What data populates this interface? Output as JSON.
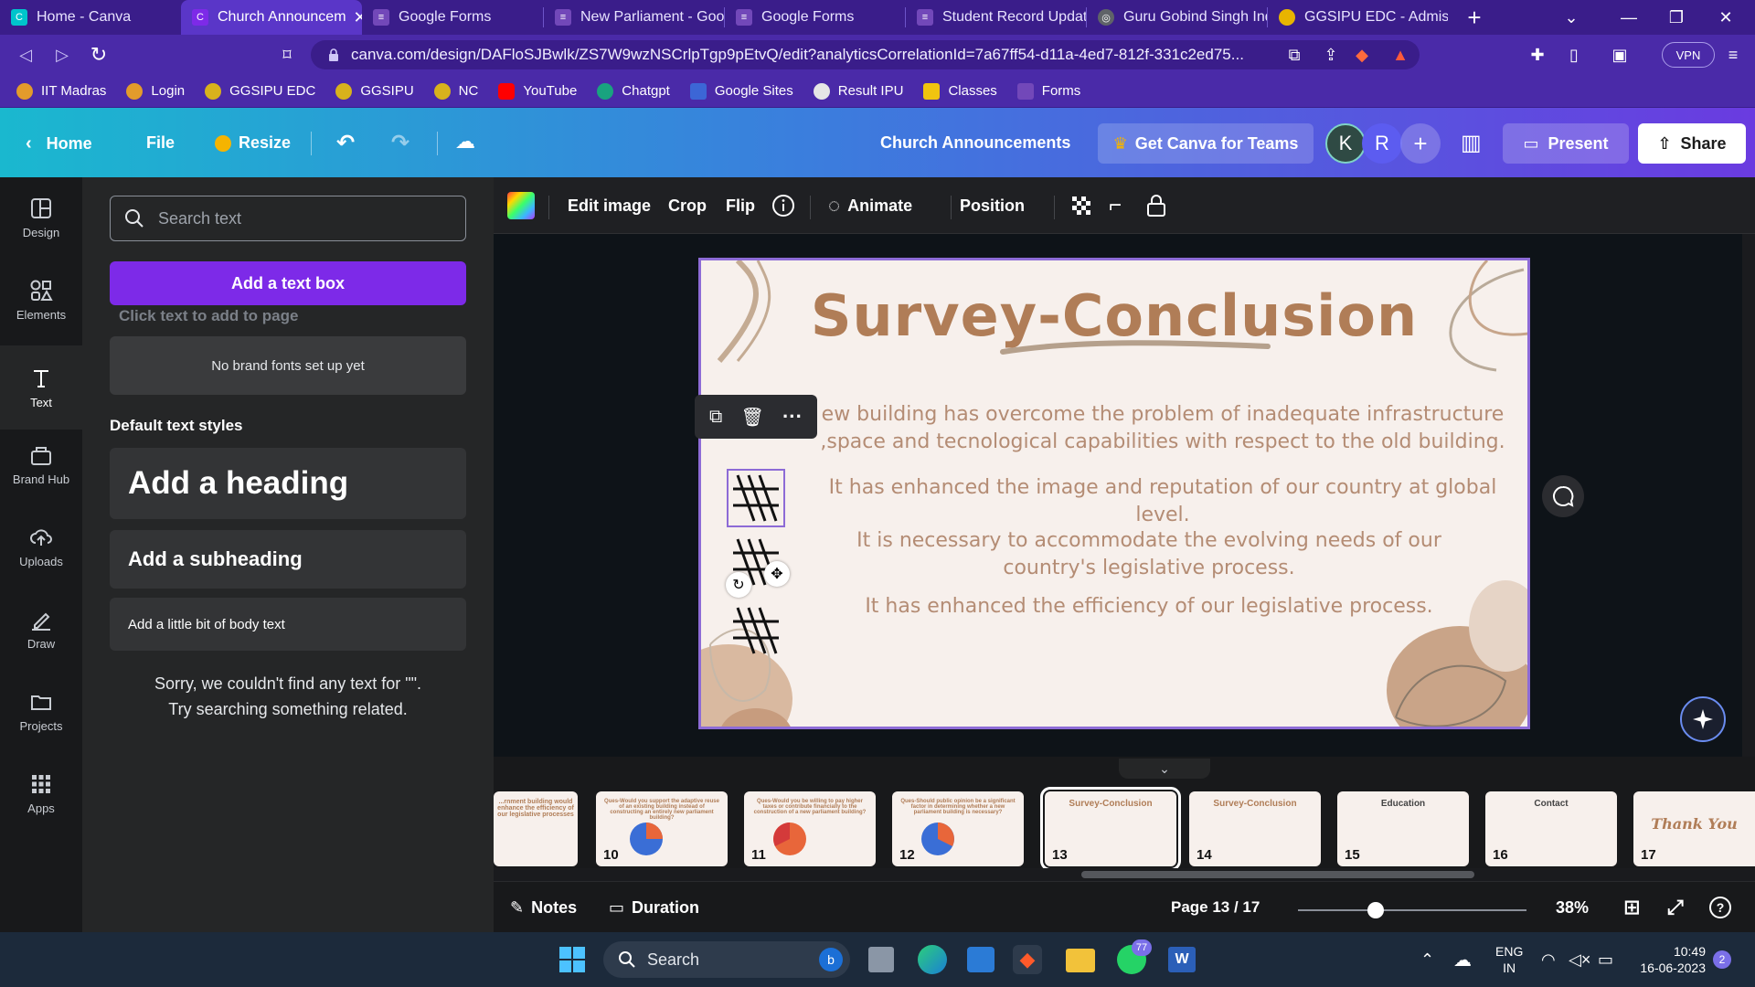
{
  "browser": {
    "tabs": [
      {
        "title": "Home - Canva",
        "color": "#00c4cc"
      },
      {
        "title": "Church Announcem",
        "color": "#7d2ae8",
        "active": true
      },
      {
        "title": "Google Forms",
        "color": "#7248b9"
      },
      {
        "title": "New Parliament - Goo",
        "color": "#7248b9"
      },
      {
        "title": "Google Forms",
        "color": "#7248b9"
      },
      {
        "title": "Student Record Updat",
        "color": "#7248b9"
      },
      {
        "title": "Guru Gobind Singh Ind",
        "color": "#5f6368"
      },
      {
        "title": "GGSIPU EDC - Admissi",
        "color": "#e8b400"
      }
    ],
    "url": "canva.com/design/DAFloSJBwlk/ZS7W9wzNSCrlpTgp9pEtvQ/edit?analyticsCorrelationId=7a67ff54-d11a-4ed7-812f-331c2ed75...",
    "vpn_label": "VPN",
    "bookmarks": [
      "IIT Madras",
      "Login",
      "GGSIPU EDC",
      "GGSIPU",
      "NC",
      "YouTube",
      "Chatgpt",
      "Google Sites",
      "Result IPU",
      "Classes",
      "Forms"
    ]
  },
  "canva": {
    "home": "Home",
    "file": "File",
    "resize": "Resize",
    "doc_title": "Church Announcements",
    "teams": "Get Canva for Teams",
    "avatars": [
      "K",
      "R"
    ],
    "present": "Present",
    "share": "Share"
  },
  "rail": [
    "Design",
    "Elements",
    "Text",
    "Brand Hub",
    "Uploads",
    "Draw",
    "Projects",
    "Apps"
  ],
  "panel": {
    "search_placeholder": "Search text",
    "add_textbox": "Add a text box",
    "click_hint": "Click text to add to page",
    "brand_fonts": "No brand fonts set up yet",
    "default_styles": "Default text styles",
    "heading": "Add a heading",
    "subheading": "Add a subheading",
    "body": "Add a little bit of body text",
    "sorry_line1": "Sorry, we couldn't find any text for \"\".",
    "sorry_line2": "Try searching something related."
  },
  "toolbar": {
    "edit_image": "Edit image",
    "crop": "Crop",
    "flip": "Flip",
    "animate": "Animate",
    "position": "Position"
  },
  "slide": {
    "title": "Survey-Conclusion",
    "points": [
      "ew building has overcome the problem of inadequate infrastructure ,space and tecnological capabilities with respect to the old building.",
      "It has enhanced the image and reputation of our country at global level.",
      "It is necessary to accommodate the evolving needs of our country's legislative process.",
      "It has enhanced the efficiency of our legislative process."
    ]
  },
  "filmstrip": [
    {
      "num": "",
      "title": "...rnment building would enhance the efficiency of our legislative processes"
    },
    {
      "num": "10",
      "title": "Ques-Would you support the adaptive reuse of an existing building instead of constructing an entirely new parliament building?"
    },
    {
      "num": "11",
      "title": "Ques-Would you be willing to pay higher taxes or contribute financially to the construction of a new parliament building?"
    },
    {
      "num": "12",
      "title": "Ques-Should public opinion be a significant factor in determining whether a new parliament building is necessary?"
    },
    {
      "num": "13",
      "title": "Survey-Conclusion",
      "selected": true
    },
    {
      "num": "14",
      "title": "Survey-Conclusion"
    },
    {
      "num": "15",
      "title": "Education"
    },
    {
      "num": "16",
      "title": "Contact"
    },
    {
      "num": "17",
      "title": "Thank You"
    }
  ],
  "bottom": {
    "notes": "Notes",
    "duration": "Duration",
    "page": "Page 13 / 17",
    "zoom": "38%"
  },
  "taskbar": {
    "search": "Search",
    "lang1": "ENG",
    "lang2": "IN",
    "time": "10:49",
    "date": "16-06-2023",
    "whatsapp_badge": "77",
    "notif_badge": "2"
  }
}
